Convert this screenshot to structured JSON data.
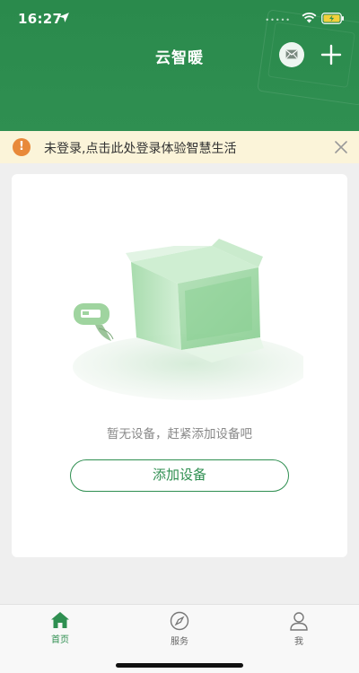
{
  "status_bar": {
    "time": "16:27",
    "signal": "•••••"
  },
  "header": {
    "title": "云智暖"
  },
  "notice": {
    "icon_text": "!",
    "text": "未登录,点击此处登录体验智慧生活"
  },
  "empty_state": {
    "message": "暂无设备，赶紧添加设备吧",
    "button_label": "添加设备"
  },
  "tabbar": {
    "items": [
      {
        "label": "首页",
        "icon": "home-icon",
        "active": true
      },
      {
        "label": "服务",
        "icon": "compass-icon",
        "active": false
      },
      {
        "label": "我",
        "icon": "user-icon",
        "active": false
      }
    ]
  },
  "colors": {
    "brand": "#2f8f51",
    "notice_bg": "#fbf4d9",
    "notice_icon": "#e8893a"
  }
}
